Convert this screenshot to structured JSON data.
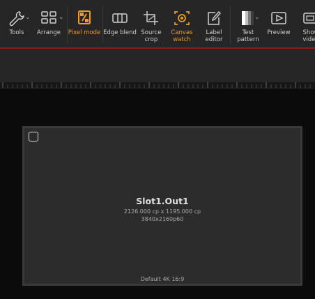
{
  "toolbar": {
    "tools_label": "Tools",
    "arrange_label": "Arrange",
    "pixel_mode_label": "Pixel mode",
    "edge_blend_label": "Edge blend",
    "source_crop_label": "Source crop",
    "canvas_watch_label": "Canvas watch",
    "label_editor_label": "Label editor",
    "test_pattern_label": "Test pattern",
    "preview_label": "Preview",
    "show_video_label": "Show video"
  },
  "accent_color": "#f29a1a",
  "output": {
    "title": "Slot1.Out1",
    "size": "2126.000 cp x 1195.000 cp",
    "format": "3840x2160p60",
    "preset": "Default 4K 16:9"
  }
}
